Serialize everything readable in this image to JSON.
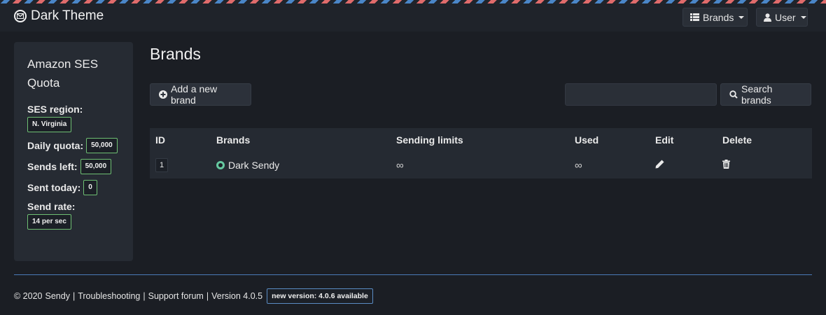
{
  "app": {
    "title": "Dark Theme"
  },
  "nav": {
    "brands_label": "Brands",
    "user_label": "User"
  },
  "sidebar": {
    "title": "Amazon SES Quota",
    "region_label": "SES region:",
    "region_value": "N. Virginia",
    "daily_quota_label": "Daily quota:",
    "daily_quota_value": "50,000",
    "sends_left_label": "Sends left:",
    "sends_left_value": "50,000",
    "sent_today_label": "Sent today:",
    "sent_today_value": "0",
    "send_rate_label": "Send rate:",
    "send_rate_value": "14 per sec"
  },
  "main": {
    "title": "Brands",
    "add_button_label": "Add a new brand",
    "search_placeholder": "",
    "search_button_label": "Search brands"
  },
  "table": {
    "headers": [
      "ID",
      "Brands",
      "Sending limits",
      "Used",
      "Edit",
      "Delete"
    ],
    "rows": [
      {
        "id": "1",
        "brand": "Dark Sendy",
        "sending_limits": "∞",
        "used": "∞"
      }
    ]
  },
  "footer": {
    "copyright": "© 2020",
    "sendy_link": "Sendy",
    "sep1": "|",
    "troubleshooting_link": "Troubleshooting",
    "sep2": "|",
    "support_link": "Support forum",
    "sep3": "|",
    "version_text": "Version 4.0.5",
    "update_badge": "new version: 4.0.6 available"
  },
  "colors": {
    "background": "#1b1e24",
    "panel": "#262b33",
    "accent_green": "#6fbf73",
    "status_dot": "#65c9a0",
    "divider_blue": "#4a7ab8"
  }
}
